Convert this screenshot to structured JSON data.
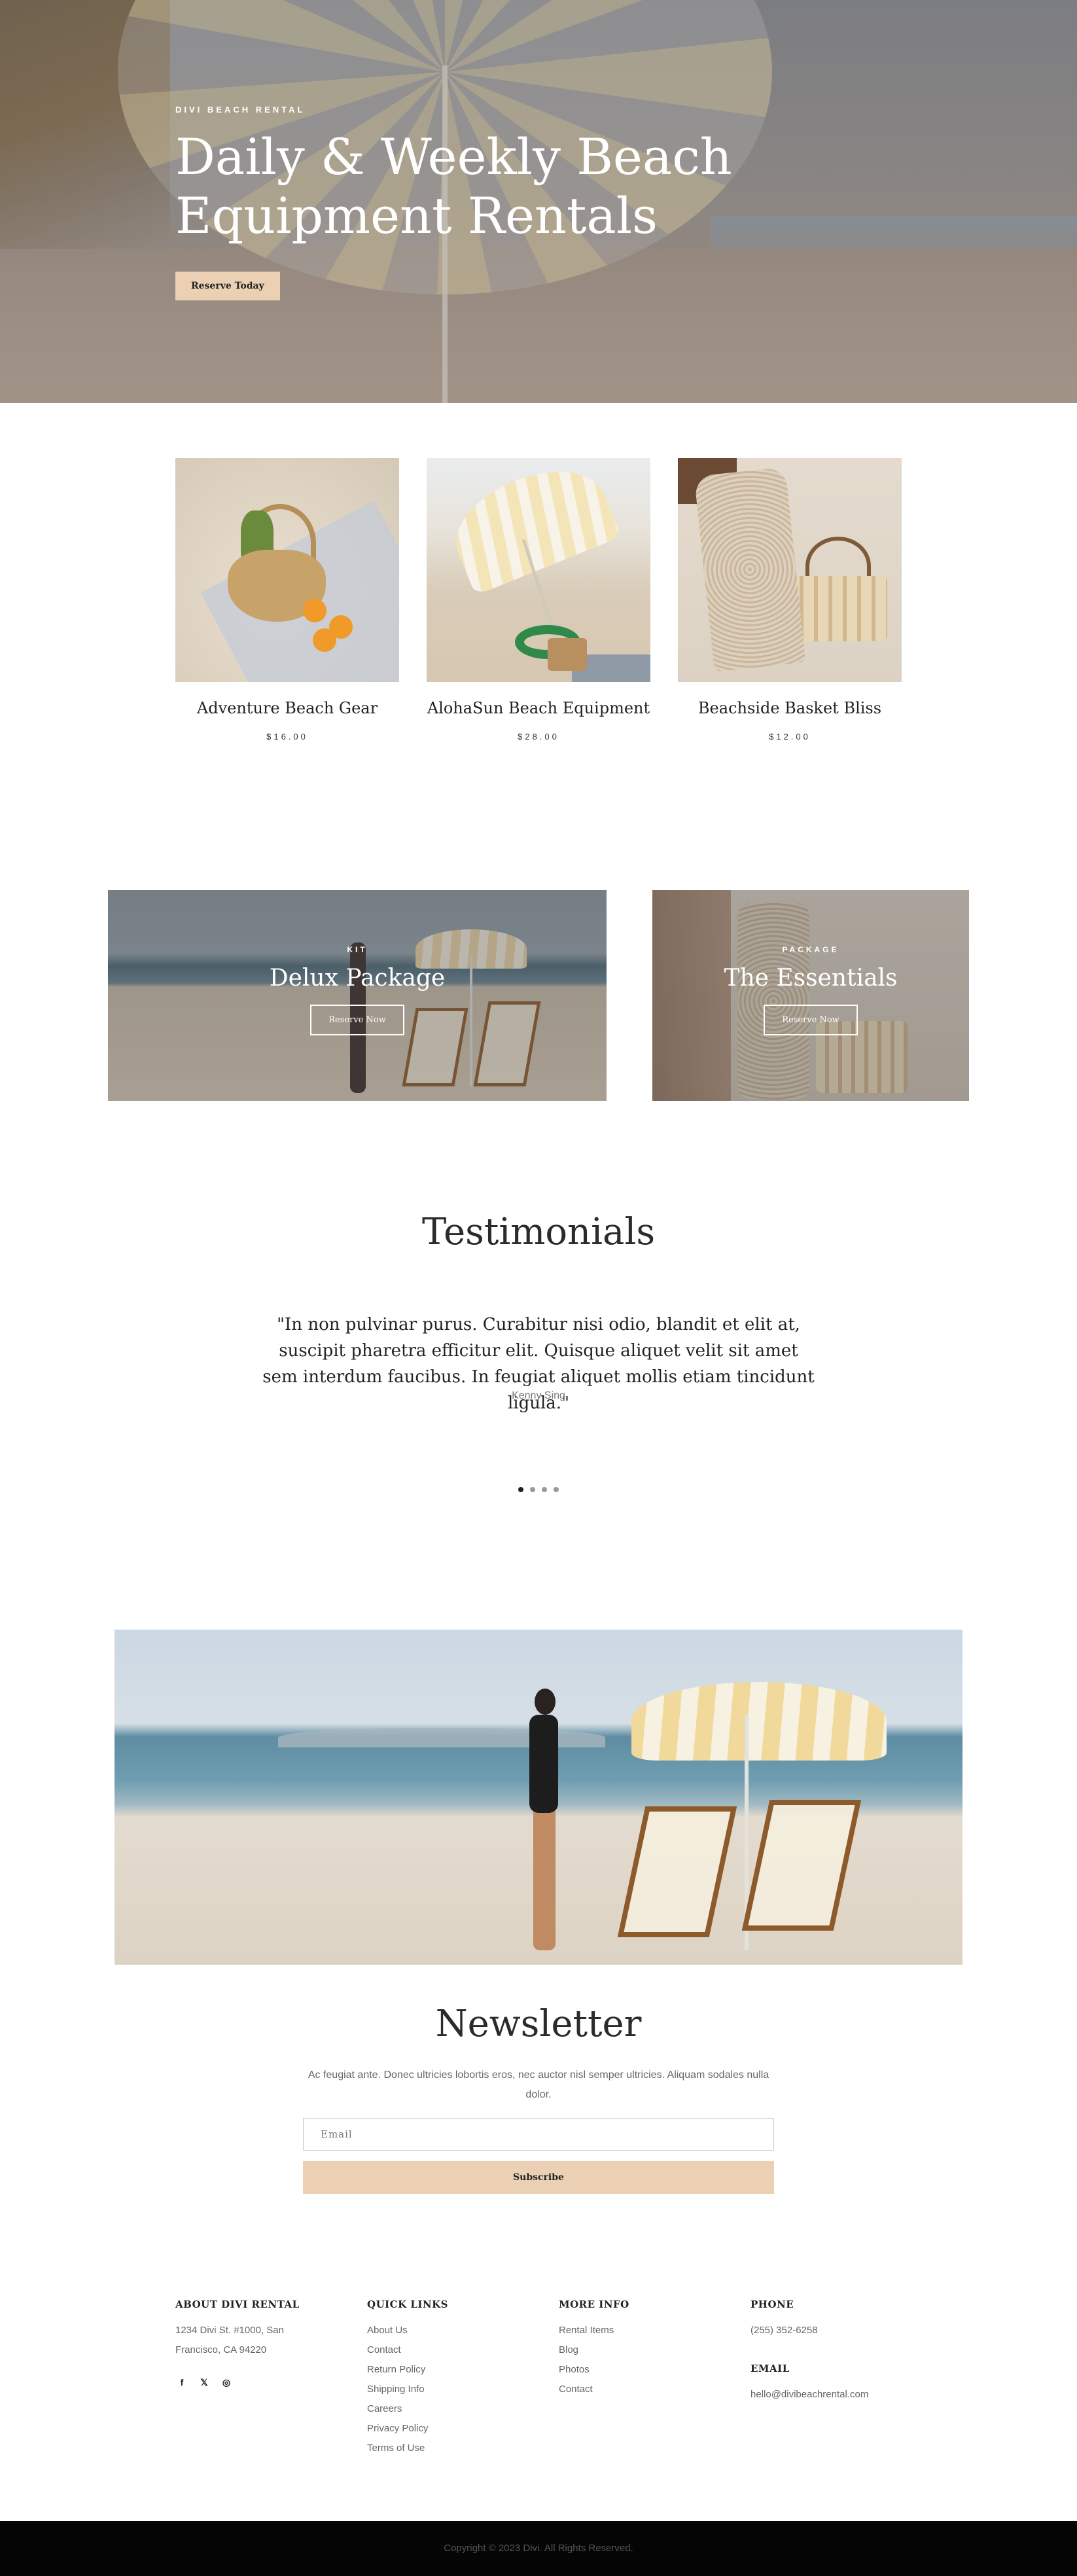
{
  "hero": {
    "eyebrow": "DIVI BEACH RENTAL",
    "title_line1": "Daily & Weekly Beach",
    "title_line2": "Equipment Rentals",
    "cta": "Reserve Today"
  },
  "products": [
    {
      "name": "Adventure Beach Gear",
      "price": "$16.00"
    },
    {
      "name": "AlohaSun Beach Equipment",
      "price": "$28.00"
    },
    {
      "name": "Beachside Basket Bliss",
      "price": "$12.00"
    }
  ],
  "packages": [
    {
      "tag": "KIT",
      "title": "Delux Package",
      "button": "Reserve Now"
    },
    {
      "tag": "PACKAGE",
      "title": "The Essentials",
      "button": "Reserve Now"
    }
  ],
  "testimonials": {
    "title": "Testimonials",
    "quote": "\"In non pulvinar purus. Curabitur nisi odio, blandit et elit at, suscipit pharetra efficitur elit. Quisque aliquet velit sit amet sem interdum faucibus. In feugiat aliquet mollis etiam tincidunt ligula.\"",
    "author": "Kenny Sing",
    "dots_total": 4,
    "active_dot": 1
  },
  "newsletter": {
    "title": "Newsletter",
    "text": "Ac feugiat ante. Donec ultricies lobortis eros, nec auctor nisl semper ultricies. Aliquam sodales nulla dolor.",
    "email_placeholder": "Email",
    "button": "Subscribe"
  },
  "footer": {
    "about": {
      "heading": "ABOUT DIVI RENTAL",
      "address_line1": "1234 Divi St. #1000, San",
      "address_line2": "Francisco, CA 94220",
      "social_icons": [
        "facebook-icon",
        "twitter-icon",
        "instagram-icon"
      ]
    },
    "quick_links": {
      "heading": "QUICK LINKS",
      "items": [
        "About Us",
        "Contact",
        "Return Policy",
        "Shipping Info",
        "Careers",
        "Privacy Policy",
        "Terms of Use"
      ]
    },
    "more_info": {
      "heading": "MORE INFO",
      "items": [
        "Rental Items",
        "Blog",
        "Photos",
        "Contact"
      ]
    },
    "phone": {
      "heading": "PHONE",
      "value": "(255) 352-6258"
    },
    "email": {
      "heading": "EMAIL",
      "value": "hello@divibeachrental.com"
    },
    "copyright": "Copyright © 2023 Divi. All Rights Reserved."
  },
  "colors": {
    "accent": "#ebd0b3",
    "text_dark": "#222222",
    "footer_bar": "#050505"
  }
}
